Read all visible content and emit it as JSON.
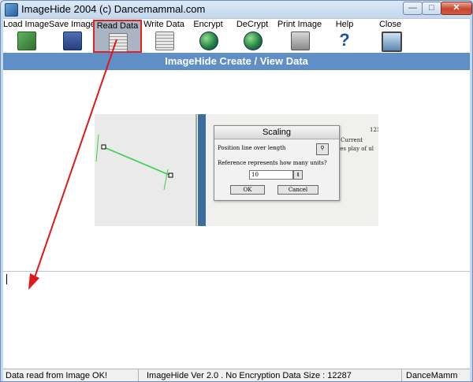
{
  "window": {
    "title": "ImageHide 2004 (c) Dancemammal.com"
  },
  "toolbar": {
    "items": [
      {
        "label": "Load Image",
        "icon": "load-image-icon"
      },
      {
        "label": "Save Image",
        "icon": "save-image-icon"
      },
      {
        "label": "Read Data",
        "icon": "read-data-icon",
        "active": true
      },
      {
        "label": "Write Data",
        "icon": "write-data-icon"
      },
      {
        "label": "Encrypt",
        "icon": "encrypt-icon"
      },
      {
        "label": "DeCrypt",
        "icon": "decrypt-icon"
      },
      {
        "label": "Print Image",
        "icon": "print-image-icon"
      },
      {
        "label": "Help",
        "icon": "help-icon"
      },
      {
        "label": "Close",
        "icon": "close-icon"
      }
    ]
  },
  "header": {
    "title": "ImageHide Create / View Data"
  },
  "embedded_image": {
    "dialog_title": "Scaling",
    "line1": "Position line over length",
    "line2": "Reference represents how many units?",
    "value": "10",
    "ok_label": "OK",
    "cancel_label": "Cancel",
    "field_value": "1",
    "field_value2": "121",
    "current_label": "Current",
    "clipped_text": "les play of ul"
  },
  "text_area": {
    "value": ""
  },
  "status": {
    "message": "Data read from Image OK!",
    "info": "ImageHide Ver 2.0 . No Encryption Data Size : 12287",
    "brand": "DanceMamm"
  },
  "colors": {
    "header_band": "#5f8fc6",
    "active_border": "#dd2222",
    "arrow": "#e01818"
  }
}
